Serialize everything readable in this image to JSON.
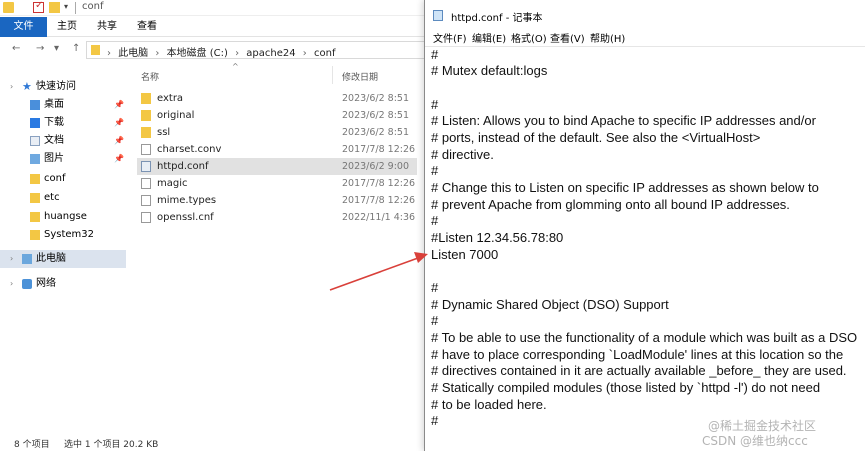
{
  "explorer": {
    "window_title": "conf",
    "ribbon_tabs": [
      "文件",
      "主页",
      "共享",
      "查看"
    ],
    "address": [
      "此电脑",
      "本地磁盘 (C:)",
      "apache24",
      "conf"
    ],
    "nav_items": [
      {
        "label": "快速访问",
        "icon": "star-icon"
      },
      {
        "label": "桌面",
        "icon": "desktop-icon",
        "pinned": true
      },
      {
        "label": "下载",
        "icon": "download-icon",
        "pinned": true
      },
      {
        "label": "文档",
        "icon": "document-icon",
        "pinned": true
      },
      {
        "label": "图片",
        "icon": "pictures-icon",
        "pinned": true
      },
      {
        "label": "conf",
        "icon": "folder-icon"
      },
      {
        "label": "etc",
        "icon": "folder-icon"
      },
      {
        "label": "huangse",
        "icon": "folder-icon"
      },
      {
        "label": "System32",
        "icon": "folder-icon"
      },
      {
        "label": "此电脑",
        "icon": "this-pc-icon",
        "selected": true
      },
      {
        "label": "网络",
        "icon": "network-icon"
      }
    ],
    "columns": {
      "name": "名称",
      "date": "修改日期"
    },
    "files": [
      {
        "name": "extra",
        "date": "2023/6/2 8:51",
        "kind": "folder"
      },
      {
        "name": "original",
        "date": "2023/6/2 8:51",
        "kind": "folder"
      },
      {
        "name": "ssl",
        "date": "2023/6/2 8:51",
        "kind": "folder"
      },
      {
        "name": "charset.conv",
        "date": "2017/7/8 12:26",
        "kind": "file"
      },
      {
        "name": "httpd.conf",
        "date": "2023/6/2 9:00",
        "kind": "conf",
        "selected": true
      },
      {
        "name": "magic",
        "date": "2017/7/8 12:26",
        "kind": "file"
      },
      {
        "name": "mime.types",
        "date": "2017/7/8 12:26",
        "kind": "file"
      },
      {
        "name": "openssl.cnf",
        "date": "2022/11/1 4:36",
        "kind": "file"
      }
    ],
    "status": {
      "count": "8 个项目",
      "selection": "选中 1 个项目  20.2 KB"
    }
  },
  "notepad": {
    "title": "httpd.conf - 记事本",
    "menu": [
      "文件(F)",
      "编辑(E)",
      "格式(O)",
      "查看(V)",
      "帮助(H)"
    ],
    "lines": [
      "#",
      "# Mutex default:logs",
      "",
      "#",
      "# Listen: Allows you to bind Apache to specific IP addresses and/or",
      "# ports, instead of the default. See also the <VirtualHost>",
      "# directive.",
      "#",
      "# Change this to Listen on specific IP addresses as shown below to",
      "# prevent Apache from glomming onto all bound IP addresses.",
      "#",
      "#Listen 12.34.56.78:80",
      "Listen 7000",
      "",
      "#",
      "# Dynamic Shared Object (DSO) Support",
      "#",
      "# To be able to use the functionality of a module which was built as a DSO",
      "# have to place corresponding `LoadModule' lines at this location so the",
      "# directives contained in it are actually available _before_ they are used.",
      "# Statically compiled modules (those listed by `httpd -l') do not need",
      "# to be loaded here.",
      "#"
    ]
  },
  "watermark": {
    "line1": "@稀土掘金技术社区",
    "line2": "CSDN @维也纳ccc"
  },
  "colors": {
    "ribbon_file_tab": "#1a66c1",
    "arrow": "#d9403a",
    "selected_row": "#e1e1e1"
  }
}
